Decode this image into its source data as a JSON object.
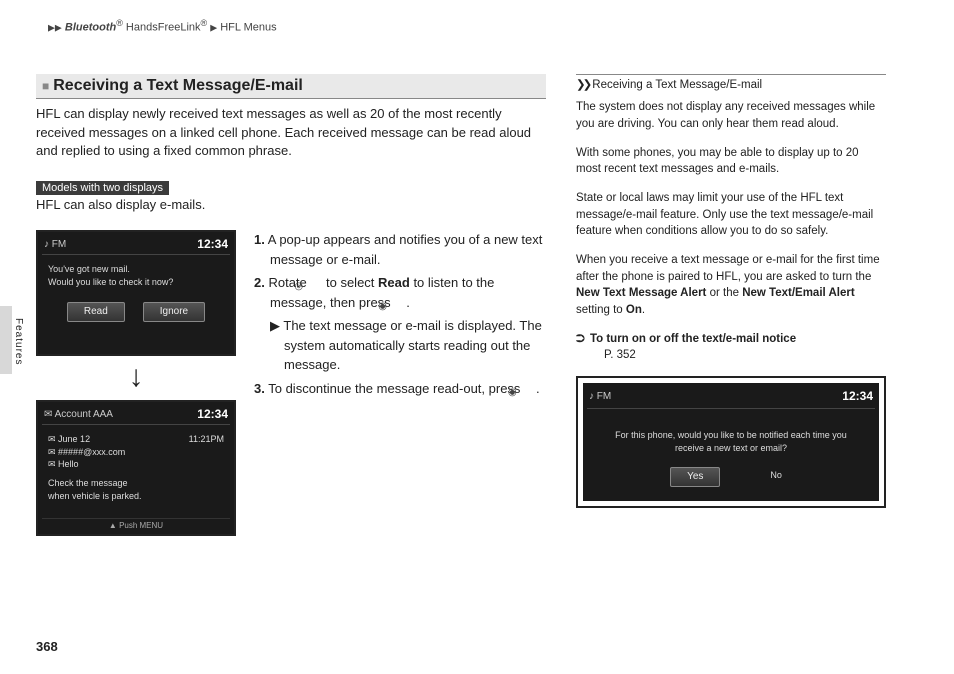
{
  "breadcrumb": {
    "part1": "Bluetooth",
    "reg1": "®",
    "part2": " HandsFreeLink",
    "reg2": "®",
    "part3": "HFL Menus"
  },
  "section": {
    "title": "Receiving a Text Message/E-mail",
    "intro": "HFL can display newly received text messages as well as 20 of the most recently received messages on a linked cell phone. Each received message can be read aloud and replied to using a fixed common phrase.",
    "tag": "Models with two displays",
    "sub_intro": "HFL can also display e-mails."
  },
  "screen1": {
    "mode": "♪  FM",
    "clock": "12:34",
    "line1": "You've got new mail.",
    "line2": "Would you like to check it now?",
    "btn_read": "Read",
    "btn_ignore": "Ignore"
  },
  "screen2": {
    "mode": "✉  Account AAA",
    "clock": "12:34",
    "row1a": "✉ June 12",
    "row1b": "11:21PM",
    "row2": "✉ #####@xxx.com",
    "row3": "✉ Hello",
    "note1": "Check the message",
    "note2": "when vehicle is parked.",
    "footer": "▲ Push MENU"
  },
  "steps": {
    "s1_num": "1.",
    "s1": "A pop-up appears and notifies you of a new text message or e-mail.",
    "s2_num": "2.",
    "s2a": "Rotate ",
    "s2b": " to select ",
    "s2_bold": "Read",
    "s2c": " to listen to the message, then press ",
    "s2d": ".",
    "s2_sub_tri": "▶",
    "s2_sub": "The text message or e-mail is displayed. The system automatically starts reading out the message.",
    "s3_num": "3.",
    "s3a": "To discontinue the message read-out, press ",
    "s3b": "."
  },
  "sidebar": {
    "title_prefix": "❯❯",
    "title": "Receiving a Text Message/E-mail",
    "p1": "The system does not display any received messages while you are driving. You can only hear them read aloud.",
    "p2": "With some phones, you may be able to display up to 20 most recent text messages and e-mails.",
    "p3": "State or local laws may limit your use of the HFL text message/e-mail feature. Only use the text message/e-mail feature when conditions allow you to do so safely.",
    "p4a": "When you receive a text message or e-mail for the first time after the phone is paired to HFL, you are asked to turn the ",
    "p4_bold1": "New Text Message Alert",
    "p4b": " or the ",
    "p4_bold2": "New Text/Email Alert",
    "p4c": " setting to ",
    "p4_bold3": "On",
    "p4d": ".",
    "crossref_icon": "⮊",
    "crossref_text": "To turn on or off the text/e-mail notice",
    "crossref_page": "P. 352"
  },
  "side_screen": {
    "mode": "♪  FM",
    "clock": "12:34",
    "msg": "For this phone, would you like to be notified each time you receive a new text or email?",
    "btn_yes": "Yes",
    "btn_no": "No"
  },
  "tab_label": "Features",
  "page_number": "368"
}
